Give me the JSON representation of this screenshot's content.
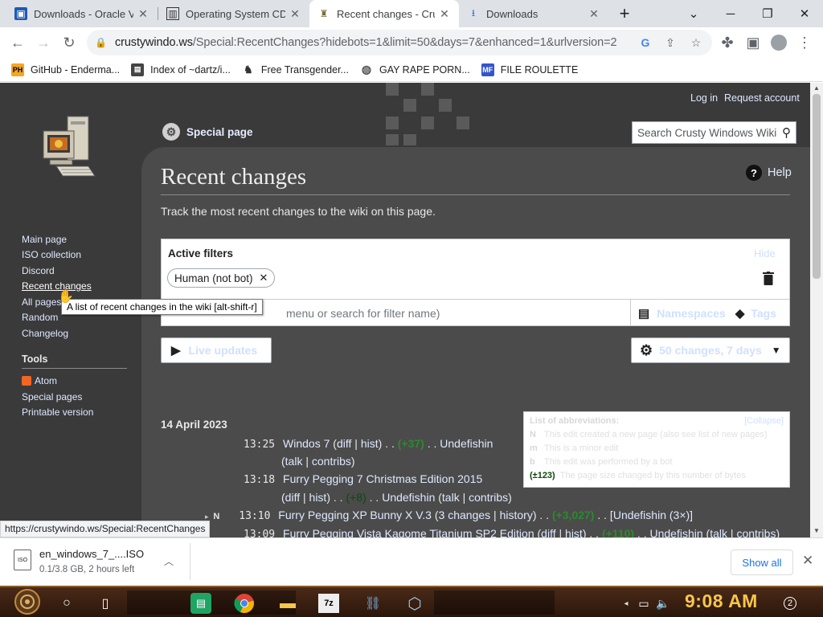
{
  "browser": {
    "tabs": [
      {
        "title": "Downloads - Oracle V",
        "icon": "virtualbox-icon"
      },
      {
        "title": "Operating System CD",
        "icon": "archive-icon"
      },
      {
        "title": "Recent changes - Cru",
        "icon": "wiki-icon",
        "active": true
      },
      {
        "title": "Downloads",
        "icon": "download-icon"
      }
    ],
    "new_tab": "+",
    "url_host": "crustywindo.ws",
    "url_path": "/Special:RecentChanges?hidebots=1&limit=50&days=7&enhanced=1&urlversion=2",
    "bookmarks": [
      {
        "label": "GitHub - Enderma...",
        "icon": "PH",
        "color": "#f5a623"
      },
      {
        "label": "Index of ~dartz/i...",
        "icon": "doc-icon",
        "color": "#444444"
      },
      {
        "label": "Free Transgender...",
        "icon": "site-icon",
        "color": "#555555"
      },
      {
        "label": "GAY RAPE PORN...",
        "icon": "globe-icon",
        "color": "#555555"
      },
      {
        "label": "FILE ROULETTE",
        "icon": "MF",
        "color": "#3355cc"
      }
    ]
  },
  "wiki": {
    "login": "Log in",
    "request_account": "Request account",
    "search_placeholder": "Search Crusty Windows Wiki",
    "special_page": "Special page",
    "title": "Recent changes",
    "help": "Help",
    "intro": "Track the most recent changes to the wiki on this page.",
    "sidebar": [
      {
        "label": "Main page"
      },
      {
        "label": "ISO collection"
      },
      {
        "label": "Discord"
      },
      {
        "label": "Recent changes",
        "active": true
      },
      {
        "label": "All pages"
      },
      {
        "label": "Random"
      },
      {
        "label": "Changelog"
      }
    ],
    "tools_heading": "Tools",
    "tools": [
      {
        "label": "Atom"
      },
      {
        "label": "Special pages"
      },
      {
        "label": "Printable version"
      }
    ],
    "tooltip": "A list of recent changes in the wiki [alt-shift-r]",
    "filters": {
      "heading": "Active filters",
      "hide": "Hide",
      "chip": "Human (not bot)",
      "input_placeholder": "menu or search for filter name)",
      "namespaces": "Namespaces",
      "tags": "Tags"
    },
    "live_updates": "Live updates",
    "changes_setting": "50 changes, 7 days",
    "date": "14 April 2023",
    "changes": [
      {
        "time": "13:25",
        "page": "Windos 7",
        "diff": "diff",
        "hist": "hist",
        "size": "(+37)",
        "user": "Undefishin",
        "talk": "talk",
        "contribs": "contribs"
      },
      {
        "time": "13:18",
        "page": "Furry Pegging 7 Christmas Edition 2015",
        "diff": "diff",
        "hist": "hist",
        "size": "(+8)",
        "user": "Undefishin",
        "talk": "talk",
        "contribs": "contribs"
      },
      {
        "time": "13:10",
        "flag": "N",
        "page": "Furry Pegging XP Bunny X V.3",
        "changes": "3 changes",
        "hist": "history",
        "size": "(+3,027)",
        "user": "Undefishin (3×)"
      },
      {
        "time": "13:09",
        "page": "Furry Pegging Vista Kagome Titanium SP2 Edition",
        "diff": "diff",
        "hist": "hist",
        "size": "(+110)",
        "user": "Undefishin",
        "talk": "talk",
        "contribs": "contribs"
      }
    ],
    "legend": {
      "heading": "List of abbreviations:",
      "collapse": "[Collapse]",
      "rows": [
        {
          "key": "N",
          "text": "This edit created a new page (also see list of new pages)"
        },
        {
          "key": "m",
          "text": "This is a minor edit"
        },
        {
          "key": "b",
          "text": "This edit was performed by a bot"
        },
        {
          "key": "(±123)",
          "text": "The page size changed by this number of bytes"
        }
      ]
    },
    "status_url": "https://crustywindo.ws/Special:RecentChanges"
  },
  "download": {
    "filename": "en_windows_7_....ISO",
    "status": "0.1/3.8 GB, 2 hours left",
    "show_all": "Show all"
  },
  "taskbar": {
    "clock": "9:08 AM",
    "notification_count": "2"
  }
}
